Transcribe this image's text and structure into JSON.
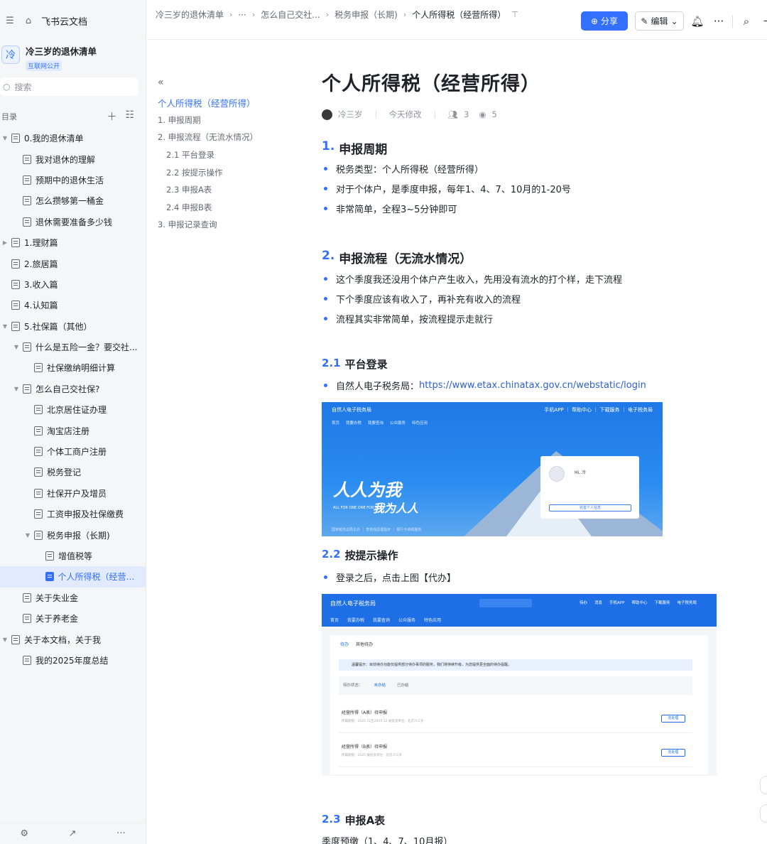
{
  "sidebar": {
    "brand": "飞书云文档",
    "wiki_title": "冷三岁的退休清单",
    "wiki_logo_char": "冷",
    "wiki_badge": "互联网公开",
    "search_placeholder": "搜索",
    "dir_label": "目录",
    "tree": [
      {
        "label": "0.我的退休清单",
        "level": 0,
        "caret": "▼"
      },
      {
        "label": "我对退休的理解",
        "level": 1,
        "caret": ""
      },
      {
        "label": "预期中的退休生活",
        "level": 1,
        "caret": ""
      },
      {
        "label": "怎么攒够第一桶金",
        "level": 1,
        "caret": ""
      },
      {
        "label": "退休需要准备多少钱",
        "level": 1,
        "caret": ""
      },
      {
        "label": "1.理财篇",
        "level": 0,
        "caret": "▶"
      },
      {
        "label": "2.旅居篇",
        "level": 0,
        "caret": ""
      },
      {
        "label": "3.收入篇",
        "level": 0,
        "caret": ""
      },
      {
        "label": "4.认知篇",
        "level": 0,
        "caret": ""
      },
      {
        "label": "5.社保篇（其他）",
        "level": 0,
        "caret": "▼"
      },
      {
        "label": "什么是五险一金？要交社...",
        "level": 1,
        "caret": "▼"
      },
      {
        "label": "社保缴纳明细计算",
        "level": 2,
        "caret": ""
      },
      {
        "label": "怎么自己交社保?",
        "level": 1,
        "caret": "▼"
      },
      {
        "label": "北京居住证办理",
        "level": 2,
        "caret": ""
      },
      {
        "label": "淘宝店注册",
        "level": 2,
        "caret": ""
      },
      {
        "label": "个体工商户注册",
        "level": 2,
        "caret": ""
      },
      {
        "label": "税务登记",
        "level": 2,
        "caret": ""
      },
      {
        "label": "社保开户及增员",
        "level": 2,
        "caret": ""
      },
      {
        "label": "工资申报及社保缴费",
        "level": 2,
        "caret": ""
      },
      {
        "label": "税务申报（长期)",
        "level": 2,
        "caret": "▼"
      },
      {
        "label": "增值税等",
        "level": 3,
        "caret": ""
      },
      {
        "label": "个人所得税（经营所...",
        "level": 3,
        "caret": "",
        "active": true
      },
      {
        "label": "关于失业金",
        "level": 1,
        "caret": ""
      },
      {
        "label": "关于养老金",
        "level": 1,
        "caret": ""
      },
      {
        "label": "关于本文档，关于我",
        "level": 0,
        "caret": "▼"
      },
      {
        "label": "我的2025年度总结",
        "level": 1,
        "caret": ""
      }
    ]
  },
  "breadcrumbs": {
    "c1": "冷三岁的退休清单",
    "c2": "···",
    "c3": "怎么自己交社...",
    "c4": "税务申报（长期)",
    "c5": "个人所得税（经营所得）"
  },
  "toolbar": {
    "share_label": "分享",
    "edit_label": "编辑"
  },
  "toc": [
    {
      "label": "个人所得税（经营所得）",
      "cls": "active"
    },
    {
      "label": "1. 申报周期",
      "cls": ""
    },
    {
      "label": "2. 申报流程（无流水情况）",
      "cls": ""
    },
    {
      "label": "2.1 平台登录",
      "cls": "l2"
    },
    {
      "label": "2.2 按提示操作",
      "cls": "l2"
    },
    {
      "label": "2.3 申报A表",
      "cls": "l2"
    },
    {
      "label": "2.4 申报B表",
      "cls": "l2"
    },
    {
      "label": "3. 申报记录查询",
      "cls": ""
    }
  ],
  "doc": {
    "title": "个人所得税（经营所得）",
    "author": "冷三岁",
    "modified": "今天修改",
    "collaborators": "3",
    "views": "5",
    "s1_num": "1.",
    "s1_title": "申报周期",
    "s1_items": [
      "税务类型：个人所得税（经营所得）",
      "对于个体户，是季度申报，每年1、4、7、10月的1-20号",
      "非常简单，全程3~5分钟即可"
    ],
    "s2_num": "2.",
    "s2_title": "申报流程（无流水情况）",
    "s2_items": [
      "这个季度我还没用个体户产生收入，先用没有流水的打个样，走下流程",
      "下个季度应该有收入了，再补充有收入的流程",
      "流程其实非常简单，按流程提示走就行"
    ],
    "s21_num": "2.1",
    "s21_title": "平台登录",
    "s21_prefix": "自然人电子税务局：",
    "s21_link": "https://www.etax.chinatax.gov.cn/webstatic/login",
    "s22_num": "2.2",
    "s22_title": "按提示操作",
    "s22_item": "登录之后，点击上图【代办】",
    "s23_num": "2.3",
    "s23_title": "申报A表",
    "s23_sub": "季度预缴（1、4、7、10月报）"
  },
  "shot1": {
    "site": "自然人电子税务局",
    "nav": [
      "首页",
      "我要办税",
      "我要查询",
      "公众服务",
      "特色应用"
    ],
    "top_links": "手机APP ｜ 帮助中心 ｜ 下载服务 ｜ 电子税务局",
    "slogan1": "人人为我",
    "slogan2": "我为人人",
    "slogan_en": "ALL FOR ONE  ONE FOR ALL",
    "bottom": "国家税务总局主办  ｜  李克强总理指示  ｜  银行卡纳税服务",
    "hi": "Hi, 冷",
    "btn": "完善个人信息"
  },
  "shot2": {
    "site": "自然人电子税务局",
    "nav": [
      "首页",
      "我要办税",
      "我要查询",
      "公众服务",
      "特色应用"
    ],
    "top_links": [
      "待办",
      "消息",
      "手机APP",
      "帮助中心",
      "下载服务",
      "电子税务局"
    ],
    "tab_on": "待办",
    "tab_off": "其他待办",
    "tip": "温馨提示：目前待办功能仅提供部分待办事项的服务，我们将持续升级，为您提供更全面的待办提醒。",
    "filter_label": "待办状态：",
    "filter_on": "未办结",
    "filter_off": "已办结",
    "rows": [
      {
        "title": "经营所得（A表）待申报",
        "sub": "所属期限：2025-11至2025-12   被投资单位：北京冷三岁",
        "btn": "去处理"
      },
      {
        "title": "经营所得（B表）待申报",
        "sub": "所属期限：2025   被投资单位：北京冷三岁",
        "btn": "去处理"
      }
    ]
  },
  "colors": {
    "accent": "#3370ff",
    "sidebar_bg": "#f5f6f7",
    "active_bg": "#e1eaff"
  }
}
